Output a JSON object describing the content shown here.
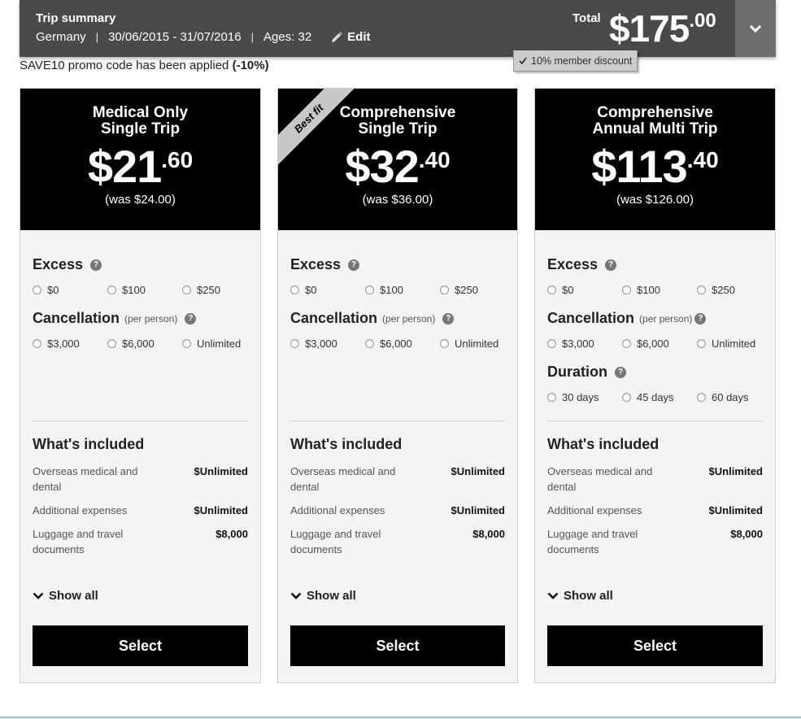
{
  "summary": {
    "title": "Trip summary",
    "destination": "Germany",
    "dates": "30/06/2015 - 31/07/2016",
    "ages": "Ages: 32",
    "separator": "|",
    "edit_label": "Edit",
    "total_label": "Total",
    "total_whole": "$175",
    "total_cents": ".00",
    "discount_badge": "10% member discount"
  },
  "promo": {
    "text": "SAVE10 promo code has been applied ",
    "discount": "(-10%)"
  },
  "plans": [
    {
      "name_line1": "Medical Only",
      "name_line2": "Single Trip",
      "price_whole": "$21",
      "price_cents": ".60",
      "was": "(was $24.00)",
      "excess_title": "Excess",
      "excess_options": [
        "$0",
        "$100",
        "$250"
      ],
      "cancellation_title": "Cancellation",
      "cancellation_sub": "(per person)",
      "cancellation_options": [
        "$3,000",
        "$6,000",
        "Unlimited"
      ],
      "included_title": "What's included",
      "included": [
        {
          "label": "Overseas medical and dental",
          "value": "$Unlimited"
        },
        {
          "label": "Additional expenses",
          "value": "$Unlimited"
        },
        {
          "label": "Luggage and travel documents",
          "value": "$8,000"
        }
      ],
      "show_all": "Show all",
      "select": "Select"
    },
    {
      "ribbon": "Best fit",
      "name_line1": "Comprehensive",
      "name_line2": "Single Trip",
      "price_whole": "$32",
      "price_cents": ".40",
      "was": "(was $36.00)",
      "excess_title": "Excess",
      "excess_options": [
        "$0",
        "$100",
        "$250"
      ],
      "cancellation_title": "Cancellation",
      "cancellation_sub": "(per person)",
      "cancellation_options": [
        "$3,000",
        "$6,000",
        "Unlimited"
      ],
      "included_title": "What's included",
      "included": [
        {
          "label": "Overseas medical and dental",
          "value": "$Unlimited"
        },
        {
          "label": "Additional expenses",
          "value": "$Unlimited"
        },
        {
          "label": "Luggage and travel documents",
          "value": "$8,000"
        }
      ],
      "show_all": "Show all",
      "select": "Select"
    },
    {
      "name_line1": "Comprehensive",
      "name_line2": "Annual Multi Trip",
      "price_whole": "$113",
      "price_cents": ".40",
      "was": "(was $126.00)",
      "excess_title": "Excess",
      "excess_options": [
        "$0",
        "$100",
        "$250"
      ],
      "cancellation_title": "Cancellation",
      "cancellation_sub": "(per person)",
      "cancellation_options": [
        "$3,000",
        "$6,000",
        "Unlimited"
      ],
      "duration_title": "Duration",
      "duration_options": [
        "30 days",
        "45 days",
        "60 days"
      ],
      "included_title": "What's included",
      "included": [
        {
          "label": "Overseas medical and dental",
          "value": "$Unlimited"
        },
        {
          "label": "Additional expenses",
          "value": "$Unlimited"
        },
        {
          "label": "Luggage and travel documents",
          "value": "$8,000"
        }
      ],
      "show_all": "Show all",
      "select": "Select"
    }
  ],
  "colors": {
    "summary_bg": "#4a4a4a",
    "card_header_bg": "#000000",
    "card_bg": "#f4f4f4",
    "button_bg": "#000000",
    "accent_line": "#8fc3df"
  }
}
